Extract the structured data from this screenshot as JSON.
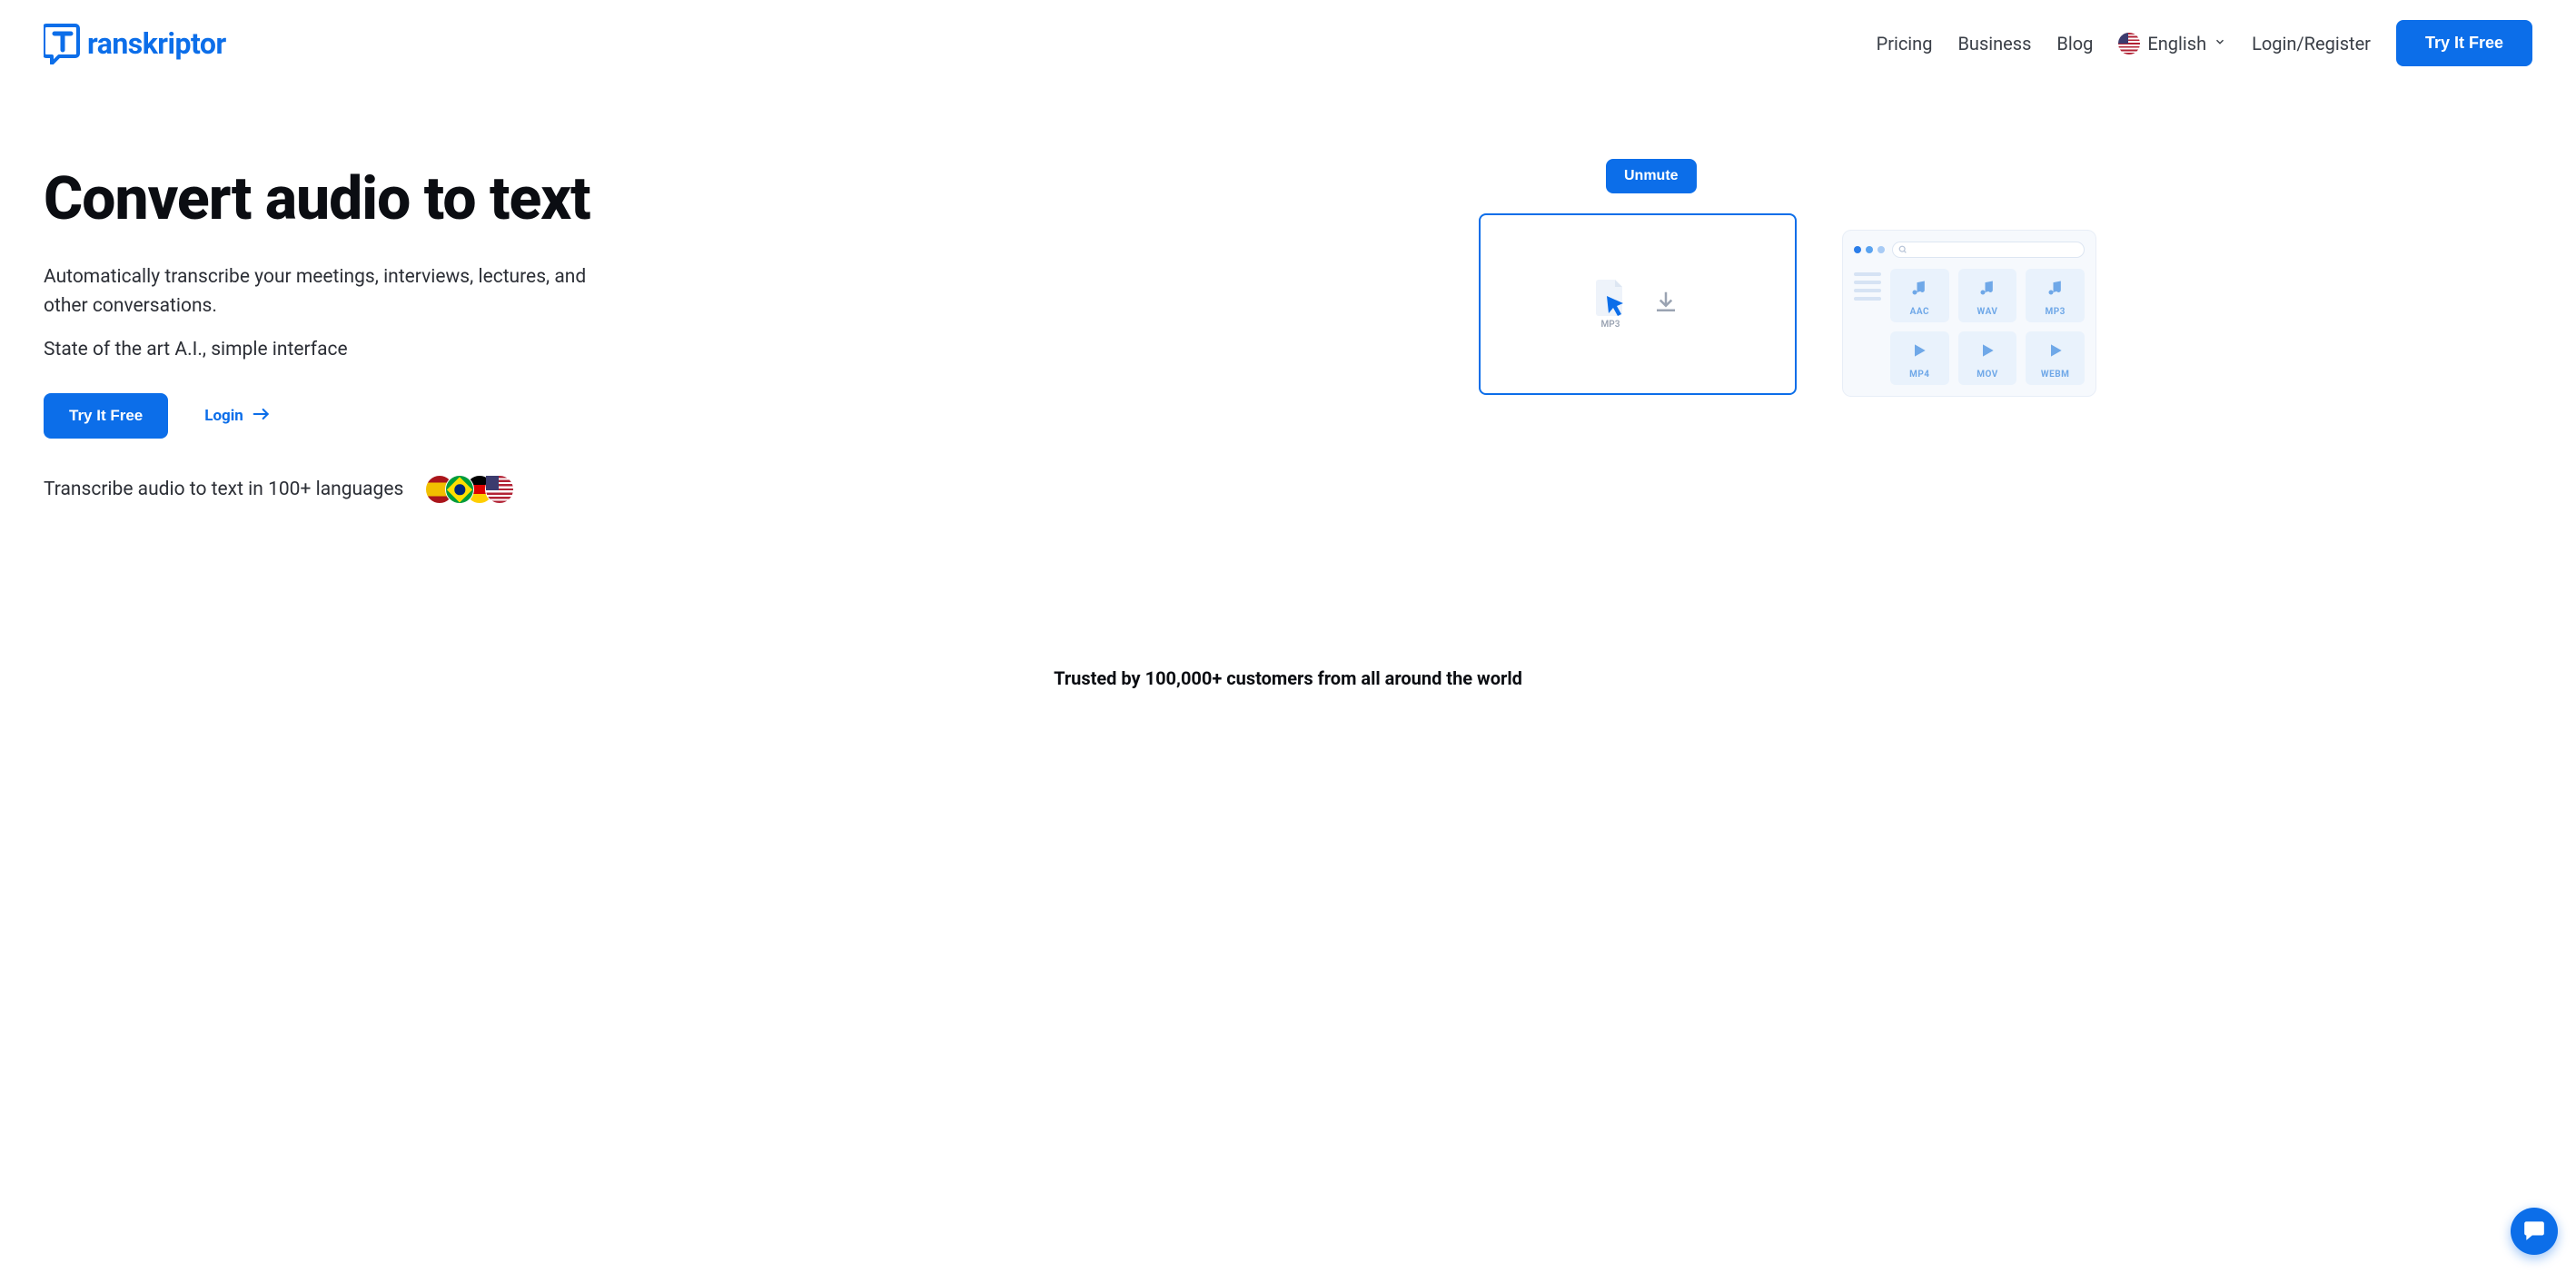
{
  "header": {
    "logo_text": "ranskriptor",
    "nav": {
      "pricing": "Pricing",
      "business": "Business",
      "blog": "Blog",
      "login_register": "Login/Register"
    },
    "language": {
      "label": "English"
    },
    "cta": "Try It Free"
  },
  "hero": {
    "title": "Convert audio to text",
    "subtitle": "Automatically transcribe your meetings, interviews, lectures, and other conversations.",
    "tagline": "State of the art A.I., simple interface",
    "try_free": "Try It Free",
    "login": "Login",
    "languages_text": "Transcribe audio to text in 100+ languages"
  },
  "illustration": {
    "unmute": "Unmute",
    "mp3_label": "MP3",
    "formats": [
      "AAC",
      "WAV",
      "MP3",
      "MP4",
      "MOV",
      "WEBM"
    ]
  },
  "trusted": "Trusted by 100,000+ customers from all around the world"
}
